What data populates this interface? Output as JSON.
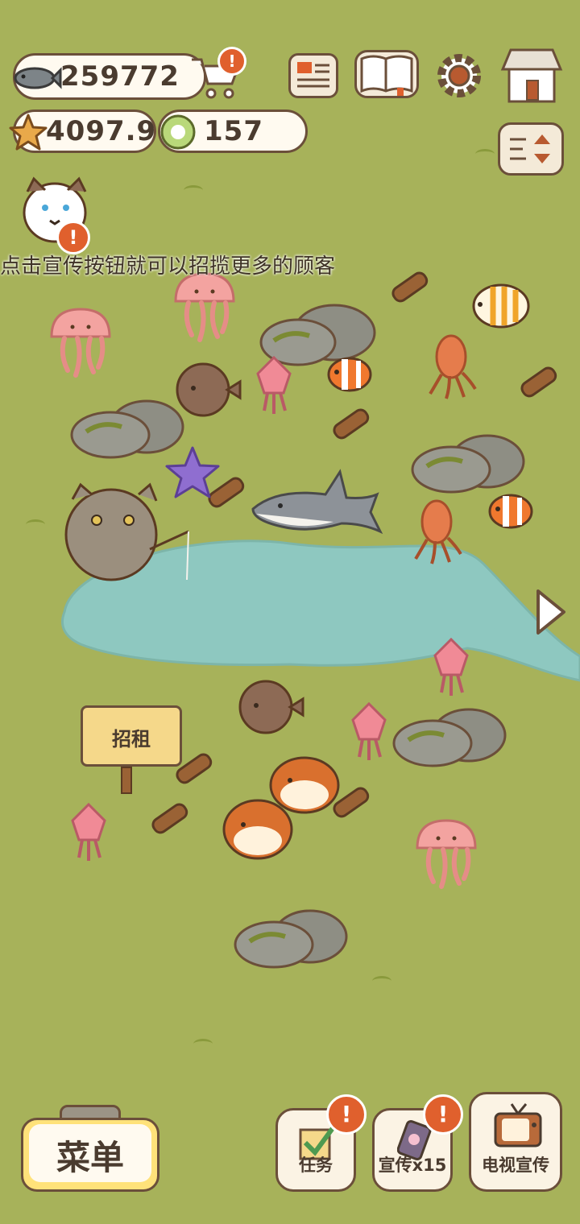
{
  "currency": {
    "fish": "259772",
    "stars": "4097.9",
    "shells": "157"
  },
  "tip_text": "点击宣传按钮就可以招揽更多的顾客",
  "sign_text": "招租",
  "buttons": {
    "menu": "菜单",
    "tasks": "任务",
    "promote": "宣传x15",
    "tv_promote": "电视宣传"
  },
  "badge_symbol": "!",
  "icons": [
    "fish-icon",
    "cart-icon",
    "newspaper-icon",
    "book-icon",
    "gear-icon",
    "shop-icon",
    "star-icon",
    "shell-icon",
    "sort-icon",
    "next-arrow-icon",
    "tv-icon",
    "phone-icon",
    "checkbox-icon"
  ],
  "colors": {
    "grass": "#a7b25a",
    "water": "#8ec8c0",
    "badge": "#e0602d",
    "border": "#6b4f3a",
    "menu_bg": "#ffe27a"
  }
}
